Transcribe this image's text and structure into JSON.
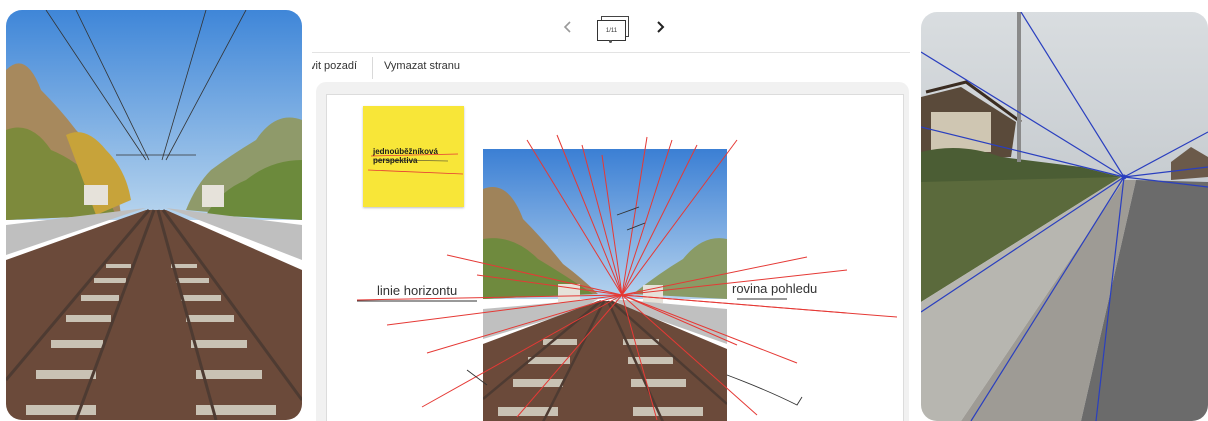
{
  "nav": {
    "page_indicator": "1/11"
  },
  "toolbar": {
    "background_label": "vit pozadí",
    "clear_label": "Vymazat stranu"
  },
  "whiteboard": {
    "sticky_note": {
      "text": "jednoúběžníková perspektiva",
      "color": "#f8e638"
    },
    "labels": {
      "horizon": "linie horizontu",
      "view_plane": "rovina pohledu"
    },
    "ink_color": "#e53935",
    "guide_line_color": "#2a3fbf"
  },
  "icons": {
    "prev": "chevron-left-icon",
    "next": "chevron-right-icon",
    "pages": "page-stack-icon"
  }
}
